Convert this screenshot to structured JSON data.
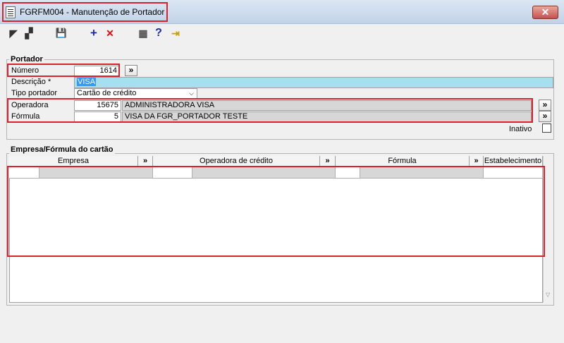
{
  "window": {
    "title": "FGRFM004 - Manutenção de Portador",
    "close_label": "✕"
  },
  "toolbar": {
    "items": [
      {
        "name": "first-record-icon",
        "glyph": "◤"
      },
      {
        "name": "restore-icon",
        "glyph": "▞"
      },
      {
        "name": "save-icon",
        "glyph": "💾"
      },
      {
        "name": "add-icon",
        "glyph": "+"
      },
      {
        "name": "delete-icon",
        "glyph": "✕"
      },
      {
        "name": "grid-icon",
        "glyph": "▦"
      },
      {
        "name": "help-icon",
        "glyph": "?"
      },
      {
        "name": "exit-icon",
        "glyph": "⇥"
      }
    ]
  },
  "portador": {
    "legend": "Portador",
    "numero_label": "Número",
    "numero_value": "1614",
    "descricao_label": "Descrição *",
    "descricao_value": "VISA",
    "tipo_label": "Tipo portador",
    "tipo_value": "Cartão de crédito",
    "operadora_label": "Operadora",
    "operadora_code": "15675",
    "operadora_name": "ADMINISTRADORA VISA",
    "formula_label": "Fórmula",
    "formula_code": "5",
    "formula_name": "VISA DA FGR_PORTADOR TESTE",
    "inativo_label": "Inativo",
    "lookup_glyph": "»"
  },
  "grid": {
    "legend": "Empresa/Fórmula do cartão",
    "columns": [
      "Empresa",
      "Operadora de crédito",
      "Fórmula",
      "Estabelecimento"
    ],
    "lookup_glyph": "»"
  },
  "colors": {
    "selection": "#3399ff",
    "highlight": "#d9232c",
    "descricao_bg": "#a6e0f0"
  }
}
